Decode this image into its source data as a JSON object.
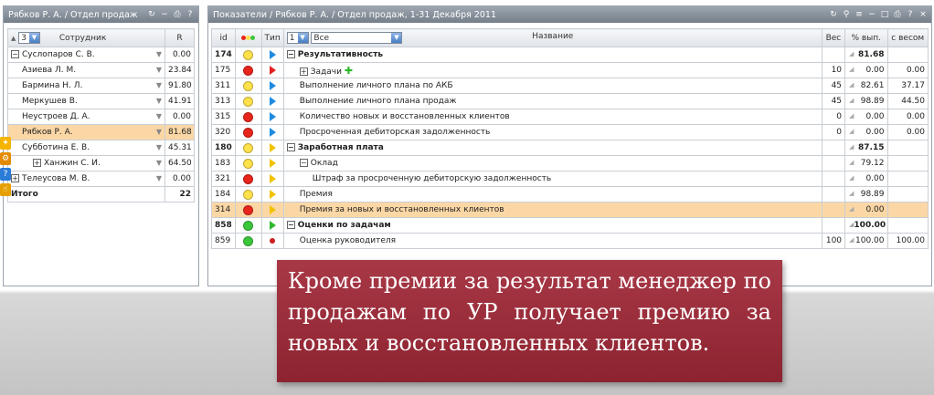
{
  "left_panel": {
    "title": "Рябков Р. А. / Отдел продаж",
    "tools": [
      "↻",
      "−",
      "⎙",
      "?"
    ],
    "header": {
      "sort_level": "3",
      "col_name": "Сотрудник",
      "col_r": "R"
    },
    "rows": [
      {
        "name": "Суслопаров С. В.",
        "value": "0.00",
        "expander": "−",
        "indent": 0
      },
      {
        "name": "Азиева Л. М.",
        "value": "23.84",
        "expander": "",
        "indent": 1
      },
      {
        "name": "Бармина Н. Л.",
        "value": "91.80",
        "expander": "",
        "indent": 1
      },
      {
        "name": "Меркушев В.",
        "value": "41.91",
        "expander": "",
        "indent": 1
      },
      {
        "name": "Неустроев Д. А.",
        "value": "0.00",
        "expander": "",
        "indent": 1
      },
      {
        "name": "Рябков Р. А.",
        "value": "81.68",
        "expander": "",
        "indent": 1,
        "highlight": true
      },
      {
        "name": "Субботина Е. В.",
        "value": "45.31",
        "expander": "",
        "indent": 1
      },
      {
        "name": "Ханжин С. И.",
        "value": "64.50",
        "expander": "+",
        "indent": 2
      },
      {
        "name": "Телеусова М. В.",
        "value": "0.00",
        "expander": "+",
        "indent": 0
      }
    ],
    "total_label": "Итого",
    "total_value": "22"
  },
  "right_panel": {
    "title": "Показатели / Рябков Р. А. / Отдел продаж, 1-31 Декабря 2011",
    "tools": [
      "↻",
      "🔍",
      "≡",
      "−",
      "□",
      "⎙",
      "?",
      "×"
    ],
    "header": {
      "id": "id",
      "type": "Тип",
      "level": "1",
      "filter": "Все",
      "name": "Название",
      "weight": "Вес",
      "pct": "% вып.",
      "weighted": "с весом"
    },
    "rows": [
      {
        "id": "174",
        "status": "yellow",
        "type": "blue",
        "name": "Результативность",
        "weight": "",
        "pct": "81.68",
        "weighted": "",
        "bold": true,
        "expander": "−",
        "indent": 0
      },
      {
        "id": "175",
        "status": "red",
        "type": "red",
        "name": "Задачи",
        "weight": "10",
        "pct": "0.00",
        "weighted": "0.00",
        "expander": "+",
        "indent": 1,
        "plus": true
      },
      {
        "id": "311",
        "status": "yellow",
        "type": "blue",
        "name": "Выполнение личного плана по АКБ",
        "weight": "45",
        "pct": "82.61",
        "weighted": "37.17",
        "indent": 1
      },
      {
        "id": "313",
        "status": "yellow",
        "type": "blue",
        "name": "Выполнение личного плана продаж",
        "weight": "45",
        "pct": "98.89",
        "weighted": "44.50",
        "indent": 1
      },
      {
        "id": "315",
        "status": "red",
        "type": "blue",
        "name": "Количество новых и восстановленных клиентов",
        "weight": "0",
        "pct": "0.00",
        "weighted": "0.00",
        "indent": 1
      },
      {
        "id": "320",
        "status": "red",
        "type": "blue",
        "name": "Просроченная дебиторская задолженность",
        "weight": "0",
        "pct": "0.00",
        "weighted": "0.00",
        "indent": 1
      },
      {
        "id": "180",
        "status": "yellow",
        "type": "yellow",
        "name": "Заработная плата",
        "weight": "",
        "pct": "87.15",
        "weighted": "",
        "bold": true,
        "expander": "−",
        "indent": 0
      },
      {
        "id": "183",
        "status": "yellow",
        "type": "yellow",
        "name": "Оклад",
        "weight": "",
        "pct": "79.12",
        "weighted": "",
        "expander": "−",
        "indent": 1
      },
      {
        "id": "321",
        "status": "red",
        "type": "yellow",
        "name": "Штраф за просроченную дебиторскую задолженность",
        "weight": "",
        "pct": "0.00",
        "weighted": "",
        "indent": 2
      },
      {
        "id": "184",
        "status": "yellow",
        "type": "yellow",
        "name": "Премия",
        "weight": "",
        "pct": "98.89",
        "weighted": "",
        "indent": 1
      },
      {
        "id": "314",
        "status": "red",
        "type": "yellow",
        "name": "Премия за новых и восстановленных клиентов",
        "weight": "",
        "pct": "0.00",
        "weighted": "",
        "indent": 1,
        "highlight": true
      },
      {
        "id": "858",
        "status": "green",
        "type": "green",
        "name": "Оценки по задачам",
        "weight": "",
        "pct": "100.00",
        "weighted": "",
        "bold": true,
        "expander": "−",
        "indent": 0
      },
      {
        "id": "859",
        "status": "green",
        "type": "reddot",
        "name": "Оценка руководителя",
        "weight": "100",
        "pct": "100.00",
        "weighted": "100.00",
        "indent": 1
      }
    ]
  },
  "callout": {
    "text": "Кроме премии за результат менеджер по продажам по УР получает  премию за новых и восстановленных клиентов."
  },
  "colors": {
    "status_yellow": "#ffe14a",
    "status_red": "#e8251b",
    "status_green": "#3bc63b",
    "type_blue": "#1f8be0",
    "type_red": "#e32020",
    "type_yellow": "#f2c200",
    "type_green": "#2eb82e",
    "highlight": "#fbd7a6",
    "callout": "#9a2b38"
  },
  "side_icons": [
    "lightbulb-icon",
    "gear-icon",
    "help-icon",
    "hand-icon"
  ]
}
